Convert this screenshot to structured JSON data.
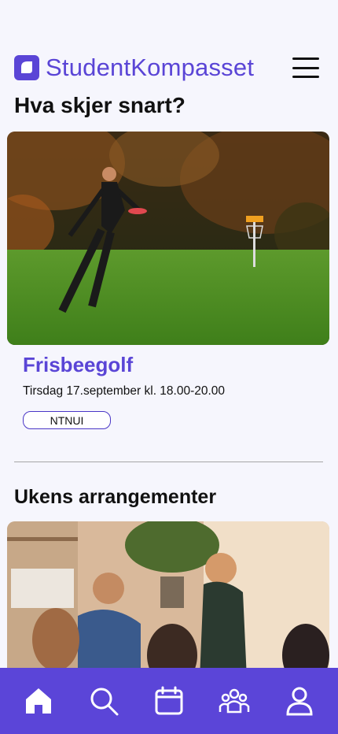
{
  "app": {
    "brand_name": "StudentKompasset",
    "brand_color": "#5a45d6",
    "nav_color": "#5b45d8"
  },
  "sections": {
    "upcoming_title": "Hva skjer snart?",
    "weekly_title": "Ukens arrangementer"
  },
  "featured_event": {
    "name": "Frisbeegolf",
    "date": "Tirsdag 17.september kl. 18.00-20.00",
    "tag": "NTNUI"
  },
  "bottom_nav": [
    {
      "icon": "home-icon",
      "active": true
    },
    {
      "icon": "search-icon"
    },
    {
      "icon": "calendar-icon"
    },
    {
      "icon": "groups-icon"
    },
    {
      "icon": "profile-icon"
    }
  ]
}
